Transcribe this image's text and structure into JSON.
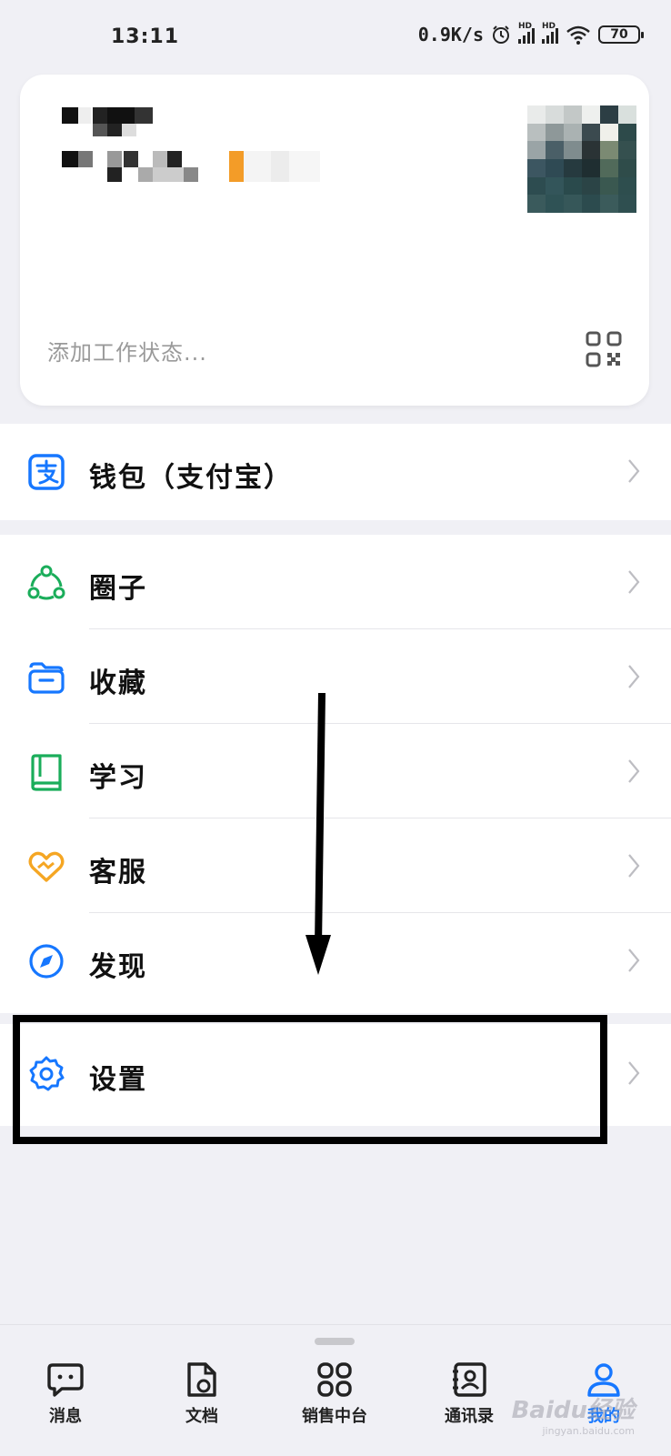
{
  "status_bar": {
    "time": "13:11",
    "net_speed": "0.9K/s",
    "hd_label": "HD",
    "battery": "70"
  },
  "profile": {
    "work_status_placeholder": "添加工作状态..."
  },
  "menu": {
    "wallet": "钱包（支付宝）",
    "circle": "圈子",
    "favorites": "收藏",
    "study": "学习",
    "service": "客服",
    "discover": "发现",
    "settings": "设置"
  },
  "tabs": [
    {
      "label": "消息",
      "icon": "chat-icon",
      "active": false
    },
    {
      "label": "文档",
      "icon": "document-icon",
      "active": false
    },
    {
      "label": "销售中台",
      "icon": "grid-icon",
      "active": false
    },
    {
      "label": "通讯录",
      "icon": "contacts-icon",
      "active": false
    },
    {
      "label": "我的",
      "icon": "person-icon",
      "active": true
    }
  ],
  "watermark": {
    "brand": "Baidu经验",
    "url": "jingyan.baidu.com"
  },
  "colors": {
    "accent": "#1677ff",
    "green": "#1aad5a",
    "orange": "#f5a623",
    "annotation": "#000000"
  }
}
